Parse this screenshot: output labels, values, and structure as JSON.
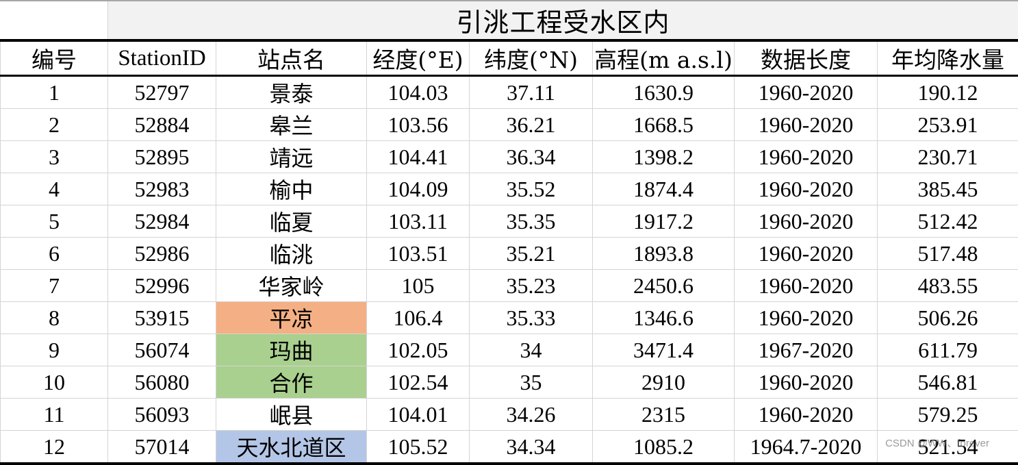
{
  "table": {
    "title": "引洮工程受水区内",
    "headers": [
      "编号",
      "StationID",
      "站点名",
      "经度(°E)",
      "纬度(°N)",
      "高程(m a.s.l)",
      "数据长度",
      "年均降水量"
    ],
    "rows": [
      {
        "no": "1",
        "id": "52797",
        "name": "景泰",
        "lon": "104.03",
        "lat": "37.11",
        "elev": "1630.9",
        "period": "1960-2020",
        "precip": "190.12",
        "highlight": ""
      },
      {
        "no": "2",
        "id": "52884",
        "name": "皋兰",
        "lon": "103.56",
        "lat": "36.21",
        "elev": "1668.5",
        "period": "1960-2020",
        "precip": "253.91",
        "highlight": ""
      },
      {
        "no": "3",
        "id": "52895",
        "name": "靖远",
        "lon": "104.41",
        "lat": "36.34",
        "elev": "1398.2",
        "period": "1960-2020",
        "precip": "230.71",
        "highlight": ""
      },
      {
        "no": "4",
        "id": "52983",
        "name": "榆中",
        "lon": "104.09",
        "lat": "35.52",
        "elev": "1874.4",
        "period": "1960-2020",
        "precip": "385.45",
        "highlight": ""
      },
      {
        "no": "5",
        "id": "52984",
        "name": "临夏",
        "lon": "103.11",
        "lat": "35.35",
        "elev": "1917.2",
        "period": "1960-2020",
        "precip": "512.42",
        "highlight": ""
      },
      {
        "no": "6",
        "id": "52986",
        "name": "临洮",
        "lon": "103.51",
        "lat": "35.21",
        "elev": "1893.8",
        "period": "1960-2020",
        "precip": "517.48",
        "highlight": ""
      },
      {
        "no": "7",
        "id": "52996",
        "name": "华家岭",
        "lon": "105",
        "lat": "35.23",
        "elev": "2450.6",
        "period": "1960-2020",
        "precip": "483.55",
        "highlight": ""
      },
      {
        "no": "8",
        "id": "53915",
        "name": "平凉",
        "lon": "106.4",
        "lat": "35.33",
        "elev": "1346.6",
        "period": "1960-2020",
        "precip": "506.26",
        "highlight": "#f4b084"
      },
      {
        "no": "9",
        "id": "56074",
        "name": "玛曲",
        "lon": "102.05",
        "lat": "34",
        "elev": "3471.4",
        "period": "1967-2020",
        "precip": "611.79",
        "highlight": "#a9d08e"
      },
      {
        "no": "10",
        "id": "56080",
        "name": "合作",
        "lon": "102.54",
        "lat": "35",
        "elev": "2910",
        "period": "1960-2020",
        "precip": "546.81",
        "highlight": "#a9d08e"
      },
      {
        "no": "11",
        "id": "56093",
        "name": "岷县",
        "lon": "104.01",
        "lat": "34.26",
        "elev": "2315",
        "period": "1960-2020",
        "precip": "579.25",
        "highlight": ""
      },
      {
        "no": "12",
        "id": "57014",
        "name": "天水北道区",
        "lon": "105.52",
        "lat": "34.34",
        "elev": "1085.2",
        "period": "1964.7-2020",
        "precip": "521.54",
        "highlight": "#b4c6e7"
      }
    ]
  },
  "watermark": "CSDN @WW、forever"
}
